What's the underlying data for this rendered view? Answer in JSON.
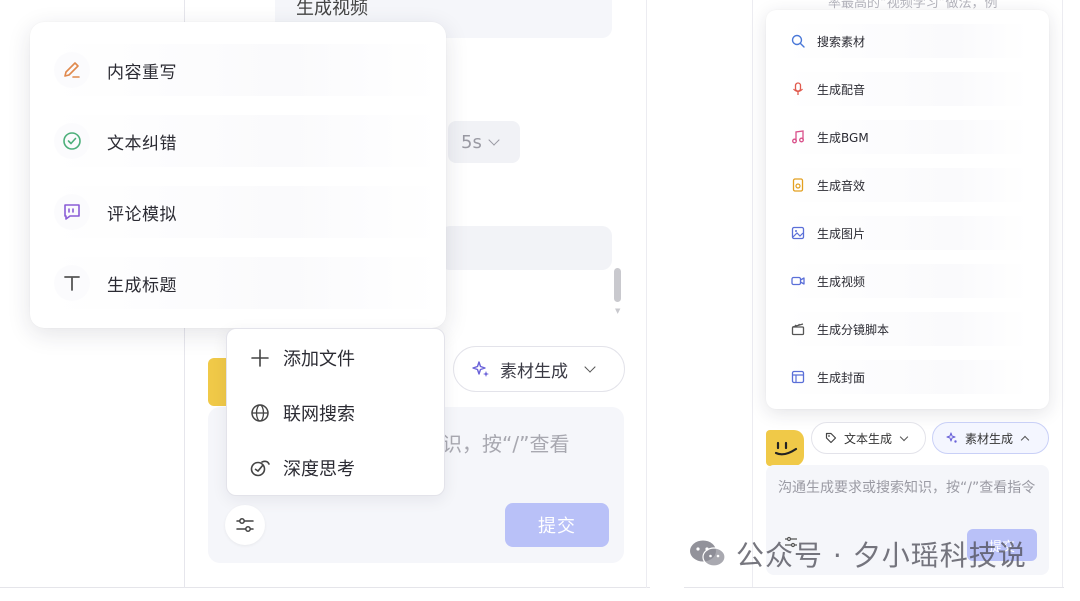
{
  "left": {
    "background_bubble_text": "生成视频",
    "duration": "5s",
    "rewrite_menu": [
      {
        "label": "内容重写",
        "icon": "pencil-icon",
        "color": "#e0894d"
      },
      {
        "label": "文本纠错",
        "icon": "check-circle-icon",
        "color": "#4caf7a"
      },
      {
        "label": "评论模拟",
        "icon": "quote-bubble-icon",
        "color": "#8a5cd6"
      },
      {
        "label": "生成标题",
        "icon": "text-t-icon",
        "color": "#555555"
      }
    ],
    "add_menu": [
      {
        "label": "添加文件",
        "icon": "plus-icon"
      },
      {
        "label": "联网搜索",
        "icon": "globe-icon"
      },
      {
        "label": "深度思考",
        "icon": "deep-think-icon"
      }
    ],
    "material_chip": "素材生成",
    "input_placeholder_visible": "识，按“/”查看",
    "submit_label": "提交"
  },
  "right": {
    "top_text": "率最高的“视频学习”做法，例",
    "material_menu": [
      {
        "label": "搜索素材",
        "icon": "search-icon",
        "color": "#4a78d8"
      },
      {
        "label": "生成配音",
        "icon": "microphone-icon",
        "color": "#e05a4d"
      },
      {
        "label": "生成BGM",
        "icon": "music-note-icon",
        "color": "#d9508a"
      },
      {
        "label": "生成音效",
        "icon": "sound-file-icon",
        "color": "#e3a020"
      },
      {
        "label": "生成图片",
        "icon": "image-icon",
        "color": "#5a6fd8"
      },
      {
        "label": "生成视频",
        "icon": "video-camera-icon",
        "color": "#5a6fd8"
      },
      {
        "label": "生成分镜脚本",
        "icon": "clapperboard-icon",
        "color": "#555555"
      },
      {
        "label": "生成封面",
        "icon": "layout-icon",
        "color": "#5a6fd8"
      }
    ],
    "text_chip": "文本生成",
    "material_chip": "素材生成",
    "input_placeholder": "沟通生成要求或搜索知识，按“/”查看指令",
    "submit_label": "提交"
  },
  "watermark": "公众号 · 夕小瑶科技说"
}
